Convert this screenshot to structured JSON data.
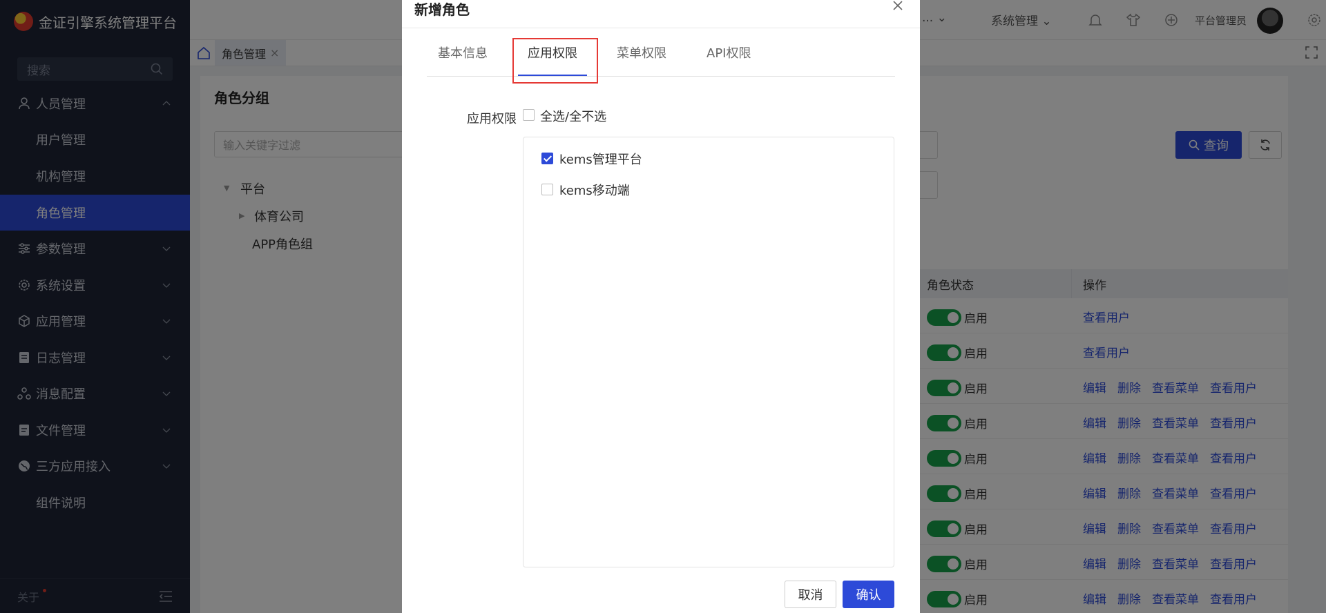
{
  "app": {
    "title": "金证引擎系统管理平台"
  },
  "sidebar": {
    "search_placeholder": "搜索",
    "items": [
      {
        "label": "人员管理",
        "icon": "user-icon"
      },
      {
        "label": "用户管理"
      },
      {
        "label": "机构管理"
      },
      {
        "label": "角色管理",
        "active": true
      },
      {
        "label": "参数管理",
        "icon": "sliders-icon"
      },
      {
        "label": "系统设置",
        "icon": "gear-icon"
      },
      {
        "label": "应用管理",
        "icon": "cube-icon"
      },
      {
        "label": "日志管理",
        "icon": "document-icon"
      },
      {
        "label": "消息配置",
        "icon": "network-icon"
      },
      {
        "label": "文件管理",
        "icon": "file-icon"
      },
      {
        "label": "三方应用接入",
        "icon": "globe-icon"
      },
      {
        "label": "组件说明"
      }
    ],
    "footer": {
      "about": "关于"
    }
  },
  "topbar": {
    "ellipsis": "...",
    "system_menu": "系统管理",
    "admin_name": "平台管理员"
  },
  "tabs": {
    "page_tab": "角色管理",
    "close": "×"
  },
  "content": {
    "group_title": "角色分组",
    "filter_placeholder": "输入关键字过滤",
    "tree": {
      "root": "平台",
      "child1": "体育公司",
      "child2": "APP角色组"
    },
    "query_button": "查询",
    "table": {
      "headers": [
        "角色状态",
        "操作"
      ],
      "status_label": "启用",
      "rows": [
        {
          "ops": [
            "查看用户"
          ]
        },
        {
          "ops": [
            "查看用户"
          ]
        },
        {
          "ops": [
            "编辑",
            "删除",
            "查看菜单",
            "查看用户"
          ]
        },
        {
          "ops": [
            "编辑",
            "删除",
            "查看菜单",
            "查看用户"
          ]
        },
        {
          "ops": [
            "编辑",
            "删除",
            "查看菜单",
            "查看用户"
          ]
        },
        {
          "ops": [
            "编辑",
            "删除",
            "查看菜单",
            "查看用户"
          ]
        },
        {
          "ops": [
            "编辑",
            "删除",
            "查看菜单",
            "查看用户"
          ]
        },
        {
          "ops": [
            "编辑",
            "删除",
            "查看菜单",
            "查看用户"
          ]
        },
        {
          "ops": [
            "编辑",
            "删除",
            "查看菜单",
            "查看用户"
          ]
        }
      ]
    }
  },
  "modal": {
    "title": "新增角色",
    "tabs": [
      "基本信息",
      "应用权限",
      "菜单权限",
      "API权限"
    ],
    "active_tab": "应用权限",
    "perm_label": "应用权限",
    "select_all": "全选/全不选",
    "apps": [
      {
        "label": "kems管理平台",
        "checked": true
      },
      {
        "label": "kems移动端",
        "checked": false
      }
    ],
    "cancel": "取消",
    "confirm": "确认"
  },
  "colors": {
    "primary": "#2d4ad8",
    "sidebar_bg": "#1e2536",
    "switch_on": "#16a34a",
    "highlight": "#e53935"
  }
}
